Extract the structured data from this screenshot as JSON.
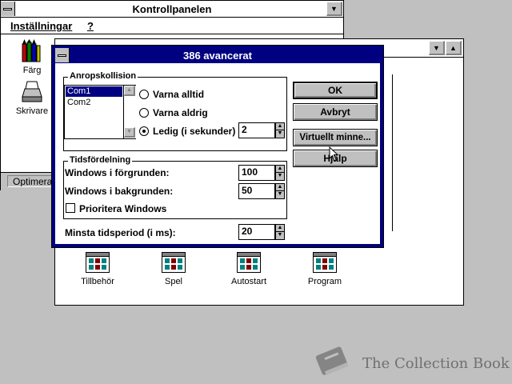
{
  "control_panel": {
    "title": "Kontrollpanelen",
    "menu": [
      "Inställningar",
      "?"
    ],
    "icons": [
      {
        "label": "Färg",
        "icon": "color-pencils-icon"
      },
      {
        "label": "Skrivare",
        "icon": "printer-icon"
      }
    ],
    "status": "Optimera"
  },
  "program_manager": {
    "groups": [
      {
        "label": "Tillbehör",
        "icon": "program-group-icon"
      },
      {
        "label": "Spel",
        "icon": "program-group-icon"
      },
      {
        "label": "Autostart",
        "icon": "program-group-icon"
      },
      {
        "label": "Program",
        "icon": "program-group-icon"
      }
    ]
  },
  "dialog": {
    "title": "386 avancerat",
    "collision": {
      "title": "Anropskollision",
      "ports": [
        "Com1",
        "Com2"
      ],
      "selected_port": "Com1",
      "options": [
        "Varna alltid",
        "Varna aldrig",
        "Ledig (i sekunder)"
      ],
      "selected_option": "Ledig (i sekunder)",
      "idle_seconds": "2"
    },
    "timing": {
      "title": "Tidsfördelning",
      "foreground_label": "Windows i förgrunden:",
      "foreground_value": "100",
      "background_label": "Windows i bakgrunden:",
      "background_value": "50",
      "priority_label": "Prioritera Windows",
      "priority_checked": false
    },
    "min_timeslice_label": "Minsta tidsperiod (i ms):",
    "min_timeslice_value": "20",
    "buttons": {
      "ok": "OK",
      "cancel": "Avbryt",
      "virtual_memory": "Virtuellt minne...",
      "help": "Hjälp"
    }
  },
  "watermark": {
    "text": "The Collection Book",
    "icon": "book-icon"
  },
  "colors": {
    "desktop": "#c0c0c0",
    "title_active": "#000080",
    "title_inactive": "#ffffff",
    "selection": "#000080"
  }
}
